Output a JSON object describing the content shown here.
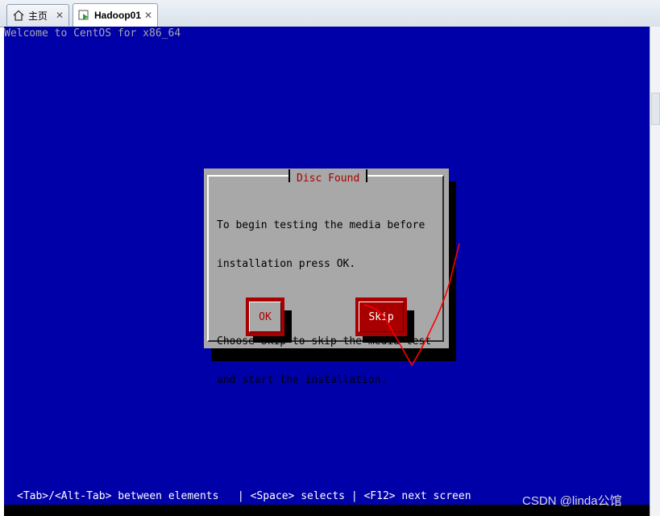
{
  "tabs": [
    {
      "label": "主页",
      "icon": "home-icon",
      "active": false
    },
    {
      "label": "Hadoop01",
      "icon": "vm-icon",
      "active": true
    }
  ],
  "console": {
    "welcome": "Welcome to CentOS for x86_64",
    "statusbar": "<Tab>/<Alt-Tab> between elements   | <Space> selects | <F12> next screen"
  },
  "dialog": {
    "title": "Disc Found",
    "text_lines": [
      "To begin testing the media before",
      "installation press OK.",
      "",
      "Choose Skip to skip the media test",
      "and start the installation."
    ],
    "ok_label": "OK",
    "skip_label": "Skip"
  },
  "watermark": "CSDN @linda公馆",
  "colors": {
    "console_bg": "#0000a8",
    "dialog_bg": "#a8a8a8",
    "accent_red": "#a80000",
    "annotation_red": "#ff0000"
  }
}
